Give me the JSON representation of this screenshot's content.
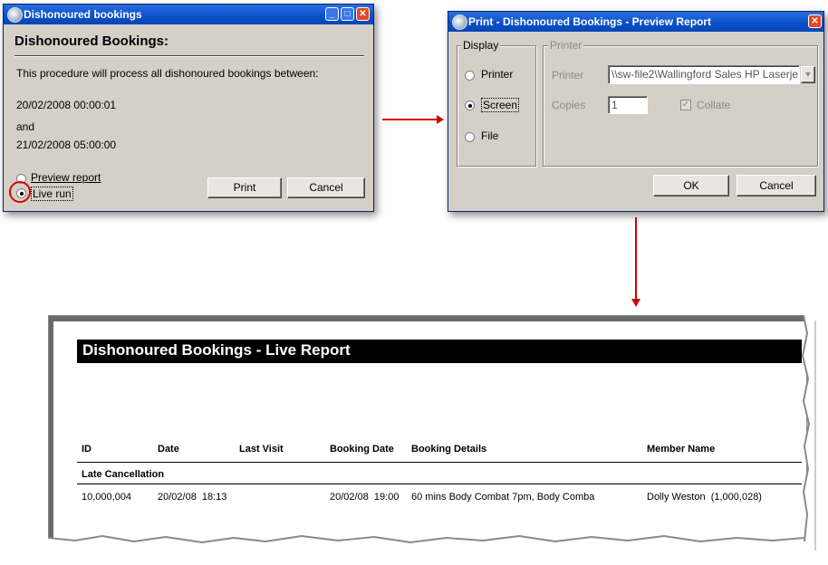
{
  "dialog1": {
    "title": "Dishonoured bookings",
    "heading": "Dishonoured Bookings:",
    "description": "This procedure will process all dishonoured bookings between:",
    "start_datetime": "20/02/2008 00:00:01",
    "and_text": "and",
    "end_datetime": "21/02/2008 05:00:00",
    "option_preview": "Preview report",
    "option_live": "Live run",
    "print_button": "Print",
    "cancel_button": "Cancel",
    "highlight_color": "#d40000"
  },
  "dialog2": {
    "title": "Print - Dishonoured Bookings - Preview Report",
    "display_group": "Display",
    "display_options": [
      "Printer",
      "Screen",
      "File"
    ],
    "selected_display": "Screen",
    "printer_group": "Printer",
    "printer_label": "Printer",
    "printer_value": "\\\\sw-file2\\Wallingford Sales HP Laserje",
    "copies_label": "Copies",
    "copies_value": "1",
    "collate_label": "Collate",
    "ok_button": "OK",
    "cancel_button": "Cancel"
  },
  "arrows": {
    "color": "#d40000"
  },
  "report": {
    "title": "Dishonoured Bookings - Live Report",
    "columns": [
      "ID",
      "Date",
      "Last Visit",
      "Booking Date",
      "Booking Details",
      "Member Name"
    ],
    "section": "Late Cancellation",
    "rows": [
      {
        "id": "10,000,004",
        "date": "20/02/08  18:13",
        "last_visit": "",
        "booking_date": "20/02/08  19:00",
        "booking_details": "60 mins Body Combat 7pm, Body Comba",
        "member_name": "Dolly Weston  (1,000,028)"
      }
    ]
  }
}
